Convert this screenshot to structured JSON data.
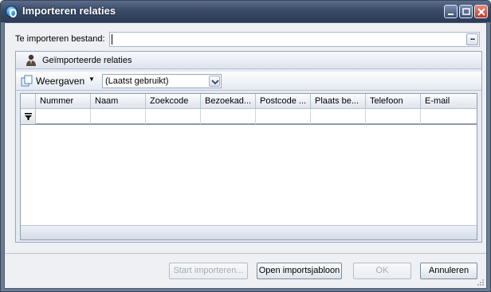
{
  "window": {
    "title": "Importeren relaties",
    "accent": "#2c3b55"
  },
  "file": {
    "label": "Te importeren bestand:",
    "value": "",
    "browse_label": "..."
  },
  "group": {
    "title": "Geïmporteerde relaties",
    "icon": "person-icon"
  },
  "toolbar": {
    "views_label": "Weergaven",
    "layout_value": "(Laatst gebruikt)"
  },
  "grid": {
    "columns": [
      "Nummer",
      "Naam",
      "Zoekcode",
      "Bezoekad...",
      "Postcode ...",
      "Plaats be...",
      "Telefoon",
      "E-mail"
    ],
    "rows": []
  },
  "buttons": {
    "start": "Start importeren...",
    "open_template": "Open importsjabloon",
    "ok": "OK",
    "cancel": "Annuleren"
  }
}
